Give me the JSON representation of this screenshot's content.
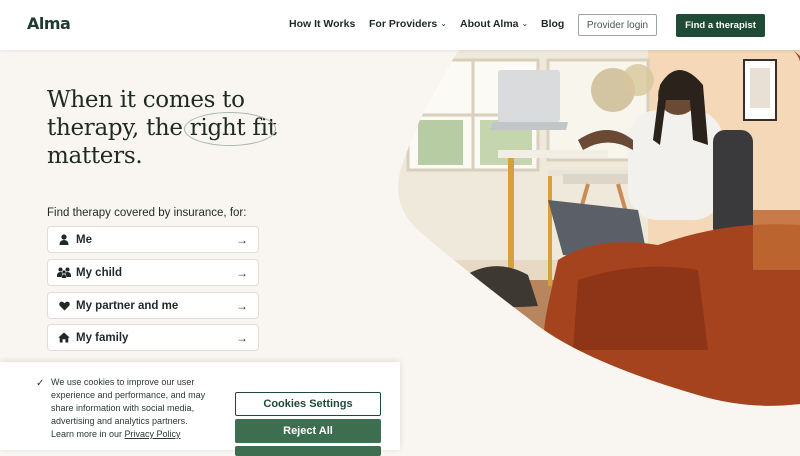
{
  "nav": {
    "logo": "Alma",
    "links": [
      {
        "label": "How It Works"
      },
      {
        "label": "For Providers"
      },
      {
        "label": "About Alma"
      },
      {
        "label": "Blog"
      }
    ],
    "provider_login": "Provider login",
    "find_therapist": "Find a therapist"
  },
  "hero": {
    "title_line1": "When it comes to",
    "title_line2_a": "therapy, the ",
    "title_line2_b": "right fit",
    "title_line3": "matters.",
    "subtitle": "Find therapy covered by insurance, for:",
    "options": [
      {
        "label": "Me",
        "icon": "person-icon"
      },
      {
        "label": "My child",
        "icon": "family-icon"
      },
      {
        "label": "My partner and me",
        "icon": "heart-icon"
      },
      {
        "label": "My family",
        "icon": "home-icon"
      }
    ]
  },
  "cookie": {
    "text": "We use cookies to improve our user experience and performance, and may share information with social media, advertising and analytics partners. Learn more in our ",
    "link": "Privacy Policy",
    "settings": "Cookies Settings",
    "reject": "Reject All"
  },
  "colors": {
    "brand": "#1f4a36",
    "accent": "#3e6e50",
    "background": "#f9f6f2"
  }
}
